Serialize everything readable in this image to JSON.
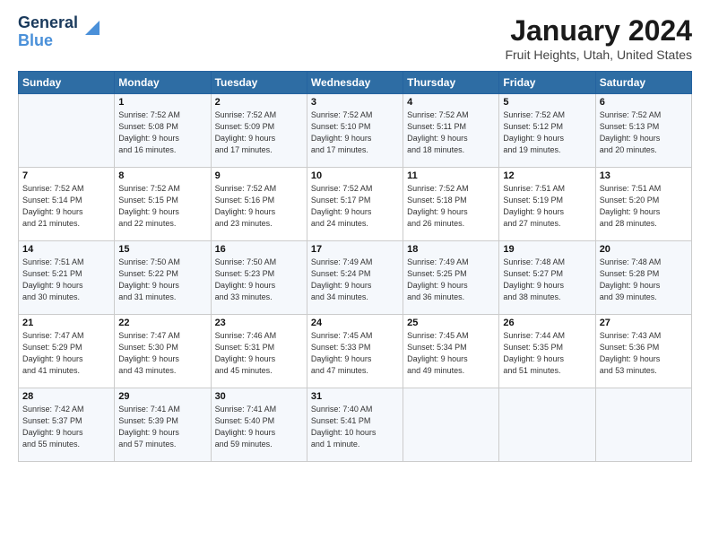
{
  "logo": {
    "line1": "General",
    "line2": "Blue"
  },
  "title": "January 2024",
  "subtitle": "Fruit Heights, Utah, United States",
  "headers": [
    "Sunday",
    "Monday",
    "Tuesday",
    "Wednesday",
    "Thursday",
    "Friday",
    "Saturday"
  ],
  "weeks": [
    [
      {
        "day": "",
        "info": ""
      },
      {
        "day": "1",
        "info": "Sunrise: 7:52 AM\nSunset: 5:08 PM\nDaylight: 9 hours\nand 16 minutes."
      },
      {
        "day": "2",
        "info": "Sunrise: 7:52 AM\nSunset: 5:09 PM\nDaylight: 9 hours\nand 17 minutes."
      },
      {
        "day": "3",
        "info": "Sunrise: 7:52 AM\nSunset: 5:10 PM\nDaylight: 9 hours\nand 17 minutes."
      },
      {
        "day": "4",
        "info": "Sunrise: 7:52 AM\nSunset: 5:11 PM\nDaylight: 9 hours\nand 18 minutes."
      },
      {
        "day": "5",
        "info": "Sunrise: 7:52 AM\nSunset: 5:12 PM\nDaylight: 9 hours\nand 19 minutes."
      },
      {
        "day": "6",
        "info": "Sunrise: 7:52 AM\nSunset: 5:13 PM\nDaylight: 9 hours\nand 20 minutes."
      }
    ],
    [
      {
        "day": "7",
        "info": "Sunrise: 7:52 AM\nSunset: 5:14 PM\nDaylight: 9 hours\nand 21 minutes."
      },
      {
        "day": "8",
        "info": "Sunrise: 7:52 AM\nSunset: 5:15 PM\nDaylight: 9 hours\nand 22 minutes."
      },
      {
        "day": "9",
        "info": "Sunrise: 7:52 AM\nSunset: 5:16 PM\nDaylight: 9 hours\nand 23 minutes."
      },
      {
        "day": "10",
        "info": "Sunrise: 7:52 AM\nSunset: 5:17 PM\nDaylight: 9 hours\nand 24 minutes."
      },
      {
        "day": "11",
        "info": "Sunrise: 7:52 AM\nSunset: 5:18 PM\nDaylight: 9 hours\nand 26 minutes."
      },
      {
        "day": "12",
        "info": "Sunrise: 7:51 AM\nSunset: 5:19 PM\nDaylight: 9 hours\nand 27 minutes."
      },
      {
        "day": "13",
        "info": "Sunrise: 7:51 AM\nSunset: 5:20 PM\nDaylight: 9 hours\nand 28 minutes."
      }
    ],
    [
      {
        "day": "14",
        "info": "Sunrise: 7:51 AM\nSunset: 5:21 PM\nDaylight: 9 hours\nand 30 minutes."
      },
      {
        "day": "15",
        "info": "Sunrise: 7:50 AM\nSunset: 5:22 PM\nDaylight: 9 hours\nand 31 minutes."
      },
      {
        "day": "16",
        "info": "Sunrise: 7:50 AM\nSunset: 5:23 PM\nDaylight: 9 hours\nand 33 minutes."
      },
      {
        "day": "17",
        "info": "Sunrise: 7:49 AM\nSunset: 5:24 PM\nDaylight: 9 hours\nand 34 minutes."
      },
      {
        "day": "18",
        "info": "Sunrise: 7:49 AM\nSunset: 5:25 PM\nDaylight: 9 hours\nand 36 minutes."
      },
      {
        "day": "19",
        "info": "Sunrise: 7:48 AM\nSunset: 5:27 PM\nDaylight: 9 hours\nand 38 minutes."
      },
      {
        "day": "20",
        "info": "Sunrise: 7:48 AM\nSunset: 5:28 PM\nDaylight: 9 hours\nand 39 minutes."
      }
    ],
    [
      {
        "day": "21",
        "info": "Sunrise: 7:47 AM\nSunset: 5:29 PM\nDaylight: 9 hours\nand 41 minutes."
      },
      {
        "day": "22",
        "info": "Sunrise: 7:47 AM\nSunset: 5:30 PM\nDaylight: 9 hours\nand 43 minutes."
      },
      {
        "day": "23",
        "info": "Sunrise: 7:46 AM\nSunset: 5:31 PM\nDaylight: 9 hours\nand 45 minutes."
      },
      {
        "day": "24",
        "info": "Sunrise: 7:45 AM\nSunset: 5:33 PM\nDaylight: 9 hours\nand 47 minutes."
      },
      {
        "day": "25",
        "info": "Sunrise: 7:45 AM\nSunset: 5:34 PM\nDaylight: 9 hours\nand 49 minutes."
      },
      {
        "day": "26",
        "info": "Sunrise: 7:44 AM\nSunset: 5:35 PM\nDaylight: 9 hours\nand 51 minutes."
      },
      {
        "day": "27",
        "info": "Sunrise: 7:43 AM\nSunset: 5:36 PM\nDaylight: 9 hours\nand 53 minutes."
      }
    ],
    [
      {
        "day": "28",
        "info": "Sunrise: 7:42 AM\nSunset: 5:37 PM\nDaylight: 9 hours\nand 55 minutes."
      },
      {
        "day": "29",
        "info": "Sunrise: 7:41 AM\nSunset: 5:39 PM\nDaylight: 9 hours\nand 57 minutes."
      },
      {
        "day": "30",
        "info": "Sunrise: 7:41 AM\nSunset: 5:40 PM\nDaylight: 9 hours\nand 59 minutes."
      },
      {
        "day": "31",
        "info": "Sunrise: 7:40 AM\nSunset: 5:41 PM\nDaylight: 10 hours\nand 1 minute."
      },
      {
        "day": "",
        "info": ""
      },
      {
        "day": "",
        "info": ""
      },
      {
        "day": "",
        "info": ""
      }
    ]
  ]
}
